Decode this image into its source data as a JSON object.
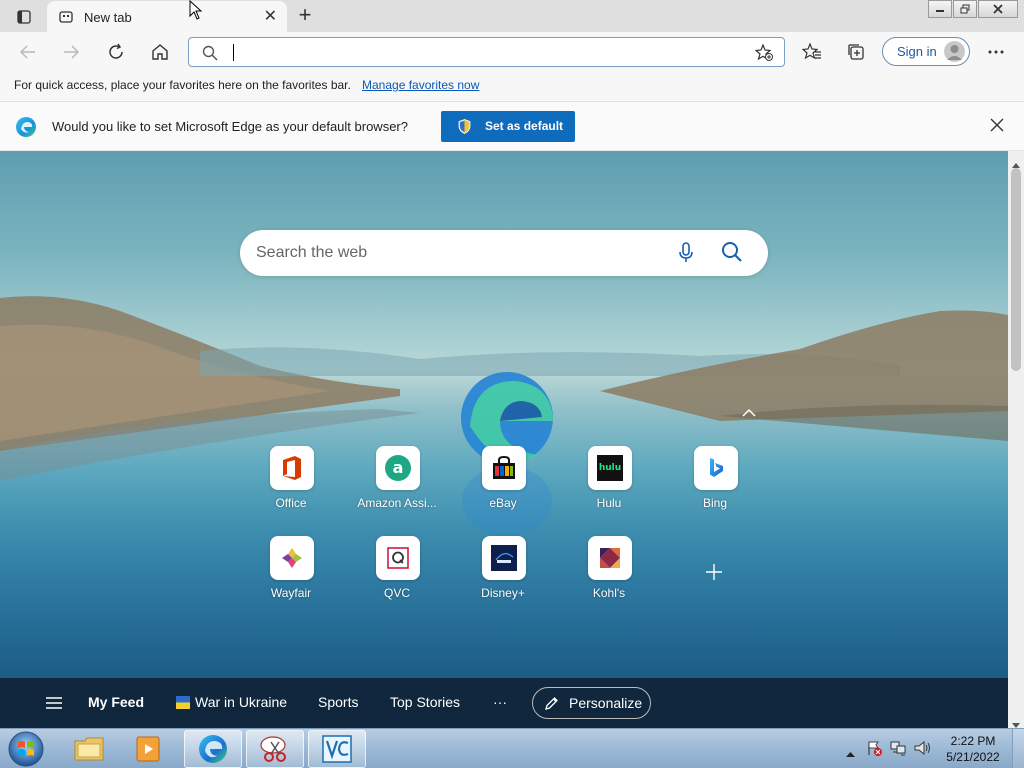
{
  "tab": {
    "title": "New tab"
  },
  "address": {
    "value": ""
  },
  "toolbar": {
    "signin_label": "Sign in"
  },
  "favbar": {
    "text": "For quick access, place your favorites here on the favorites bar.",
    "link": "Manage favorites now"
  },
  "default_prompt": {
    "message": "Would you like to set Microsoft Edge as your default browser?",
    "button": "Set as default"
  },
  "search": {
    "placeholder": "Search the web"
  },
  "quicklinks": [
    {
      "label": "Office",
      "icon": "office-icon"
    },
    {
      "label": "Amazon Assi...",
      "icon": "amazon-icon"
    },
    {
      "label": "eBay",
      "icon": "ebay-icon"
    },
    {
      "label": "Hulu",
      "icon": "hulu-icon",
      "text": "hulu"
    },
    {
      "label": "Bing",
      "icon": "bing-icon"
    },
    {
      "label": "Wayfair",
      "icon": "wayfair-icon"
    },
    {
      "label": "QVC",
      "icon": "qvc-icon"
    },
    {
      "label": "Disney+",
      "icon": "disney-icon"
    },
    {
      "label": "Kohl's",
      "icon": "kohls-icon"
    }
  ],
  "feed": {
    "items": [
      "My Feed",
      "War in Ukraine",
      "Sports",
      "Top Stories",
      "···"
    ],
    "personalize": "Personalize"
  },
  "taskbar": {
    "time": "2:22 PM",
    "date": "5/21/2022"
  },
  "colors": {
    "accent": "#0f6cbd",
    "link": "#0a58b8"
  }
}
